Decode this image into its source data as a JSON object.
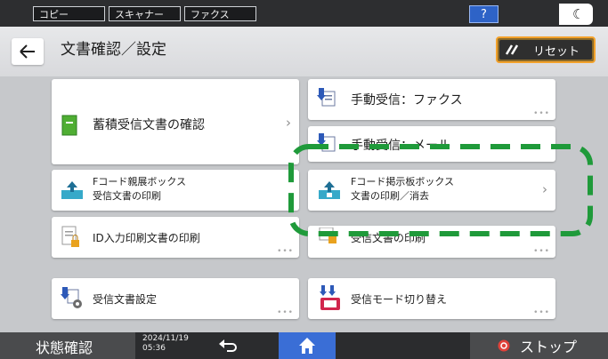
{
  "topbar": {
    "tabs": [
      "コピー",
      "スキャナー",
      "ファクス"
    ],
    "help_label": "?",
    "moon_glyph": "☾"
  },
  "header": {
    "title": "文書確認／設定",
    "reset_label": "リセット"
  },
  "main": {
    "stored_docs": "蓄積受信文書の確認",
    "manual_fax": "手動受信：ファクス",
    "manual_mail": "手動受信：メール",
    "f_personal_line1": "Fコード親展ボックス",
    "f_personal_line2": "受信文書の印刷",
    "f_bulletin_line1": "Fコード掲示板ボックス",
    "f_bulletin_line2": "文書の印刷／消去",
    "id_print": "ID入力印刷文書の印刷",
    "locked_print": "受信文書の印刷",
    "receive_settings": "受信文書設定",
    "receive_mode": "受信モード切り替え"
  },
  "bottom": {
    "status_label": "状態確認",
    "date": "2024/11/19",
    "time": "05:36",
    "stop_label": "ストップ"
  },
  "colors": {
    "highlight_dash": "#1f9a3a",
    "home_blue": "#3a6ed6",
    "reset_orange": "#f3a22b"
  }
}
